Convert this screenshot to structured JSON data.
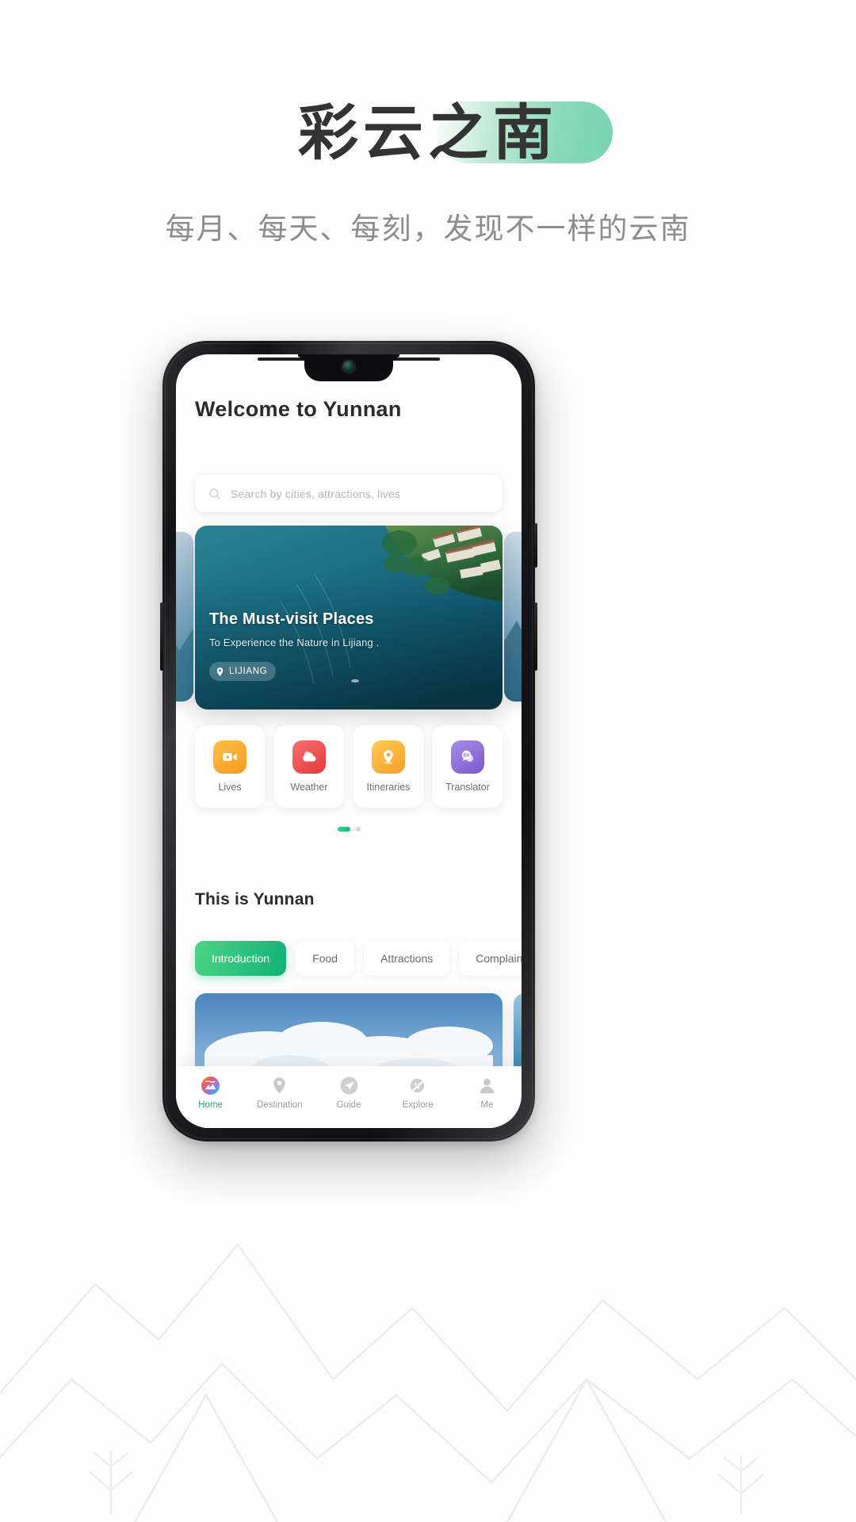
{
  "poster": {
    "title": "彩云之南",
    "subtitle": "每月、每天、每刻，发现不一样的云南",
    "accent_green": "#12b776",
    "highlight_green": "#7ed6b3",
    "title_color": "#333333",
    "subtitle_color": "#8d8d8d"
  },
  "app": {
    "welcome_title": "Welcome  to\nYunnan",
    "search": {
      "placeholder": "Search by cities, attractions, lives",
      "icon": "search-icon"
    },
    "hero": {
      "title": "The Must-visit Places",
      "subtitle": "To Experience the Nature in Lijiang .",
      "badge_label": "LIJIANG",
      "badge_icon": "location-pin-icon"
    },
    "quick_actions": [
      {
        "label": "Lives",
        "icon": "video-camera-icon",
        "color": "#fcb040",
        "color2": "#f99a1c"
      },
      {
        "label": "Weather",
        "icon": "cloud-icon",
        "color": "#f4615f",
        "color2": "#e8393c"
      },
      {
        "label": "Itineraries",
        "icon": "map-pin-icon",
        "color": "#fcc044",
        "color2": "#f9a02a"
      },
      {
        "label": "Translator",
        "icon": "translate-chat-icon",
        "color": "#9b7ce0",
        "color2": "#7c5cd1",
        "badge_text": "EN"
      }
    ],
    "carousel_dots": {
      "count": 2,
      "active_index": 0
    },
    "section_title": "This is Yunnan",
    "tabs": [
      {
        "label": "Introduction",
        "active": true
      },
      {
        "label": "Food",
        "active": false
      },
      {
        "label": "Attractions",
        "active": false
      },
      {
        "label": "Complaints",
        "active": false
      }
    ],
    "bottom_nav": [
      {
        "label": "Home",
        "icon": "home-mountain-icon",
        "active": true
      },
      {
        "label": "Destination",
        "icon": "location-pin-icon",
        "active": false
      },
      {
        "label": "Guide",
        "icon": "paper-plane-icon",
        "active": false
      },
      {
        "label": "Explore",
        "icon": "planet-icon",
        "active": false
      },
      {
        "label": "Me",
        "icon": "person-icon",
        "active": false
      }
    ]
  }
}
